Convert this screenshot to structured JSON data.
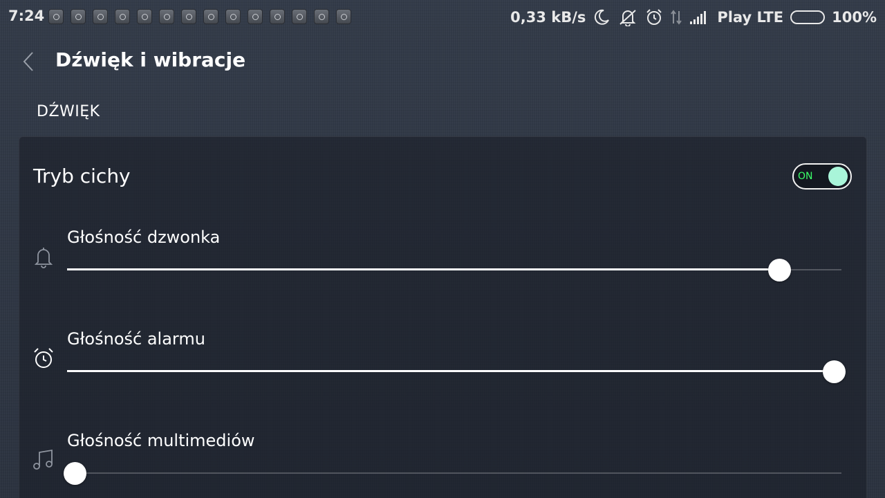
{
  "status_bar": {
    "time": "7:24",
    "notification_icons": [
      "app-notification-icon",
      "app-notification-icon",
      "app-notification-icon",
      "app-notification-icon",
      "app-notification-icon",
      "app-notification-icon",
      "app-notification-icon",
      "app-notification-icon",
      "app-notification-icon",
      "app-notification-icon",
      "app-notification-icon",
      "app-notification-icon",
      "app-notification-icon",
      "app-notification-icon"
    ],
    "network_speed": "0,33 kB/s",
    "carrier": "Play LTE",
    "battery_percent": "100%"
  },
  "header": {
    "title": "Dźwięk i wibracje"
  },
  "section": {
    "title": "DŹWIĘK"
  },
  "silent_mode": {
    "label": "Tryb cichy",
    "toggle_text": "ON",
    "enabled": true
  },
  "volumes": {
    "ringtone": {
      "label": "Głośność dzwonka",
      "level": 0.92,
      "icon": "bell-icon"
    },
    "alarm": {
      "label": "Głośność alarmu",
      "level": 0.99,
      "icon": "alarm-clock-icon"
    },
    "media": {
      "label": "Głośność multimediów",
      "level": 0.01,
      "icon": "music-note-icon"
    }
  },
  "colors": {
    "background": "#2f3745",
    "toggle_on_text": "#3cff6a",
    "toggle_knob": "#a9f5d9",
    "slider_active": "#ffffff"
  }
}
